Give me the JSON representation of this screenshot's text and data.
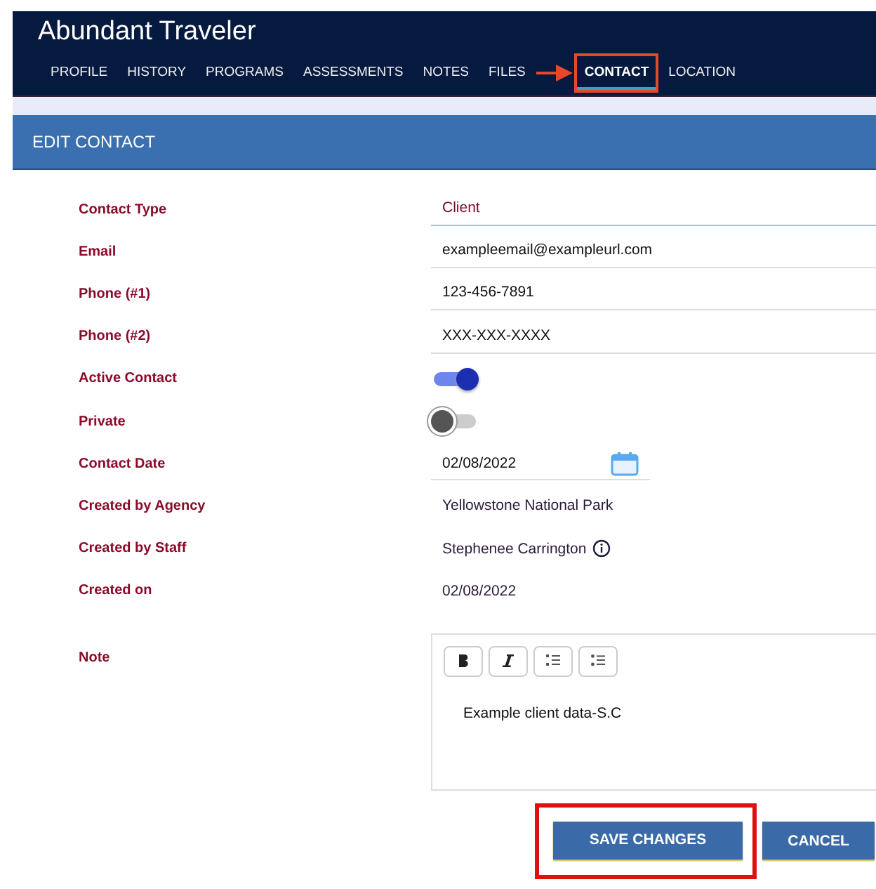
{
  "app_title": "Abundant Traveler",
  "tabs": [
    {
      "label": "PROFILE",
      "selected": false
    },
    {
      "label": "HISTORY",
      "selected": false
    },
    {
      "label": "PROGRAMS",
      "selected": false
    },
    {
      "label": "ASSESSMENTS",
      "selected": false
    },
    {
      "label": "NOTES",
      "selected": false
    },
    {
      "label": "FILES",
      "selected": false
    },
    {
      "label": "CONTACT",
      "selected": true
    },
    {
      "label": "LOCATION",
      "selected": false
    }
  ],
  "section_title": "EDIT CONTACT",
  "fields": [
    {
      "kind": "select",
      "label": "Contact Type",
      "value": "Client"
    },
    {
      "kind": "text",
      "label": "Email",
      "value": "exampleemail@exampleurl.com"
    },
    {
      "kind": "text",
      "label": "Phone (#1)",
      "value": "123-456-7891"
    },
    {
      "kind": "text",
      "label": "Phone (#2)",
      "value": "XXX-XXX-XXXX"
    },
    {
      "kind": "toggle",
      "label": "Active Contact",
      "on": true
    },
    {
      "kind": "toggle",
      "label": "Private",
      "on": false
    },
    {
      "kind": "date",
      "label": "Contact Date",
      "value": "02/08/2022"
    },
    {
      "kind": "static",
      "label": "Created by Agency",
      "value": "Yellowstone National Park"
    },
    {
      "kind": "info",
      "label": "Created by Staff",
      "value": "Stephenee Carrington"
    },
    {
      "kind": "static",
      "label": "Created on",
      "value": "02/08/2022"
    }
  ],
  "note": {
    "label": "Note",
    "value": "Example client data-S.C"
  },
  "buttons": [
    "SAVE CHANGES",
    "CANCEL"
  ]
}
